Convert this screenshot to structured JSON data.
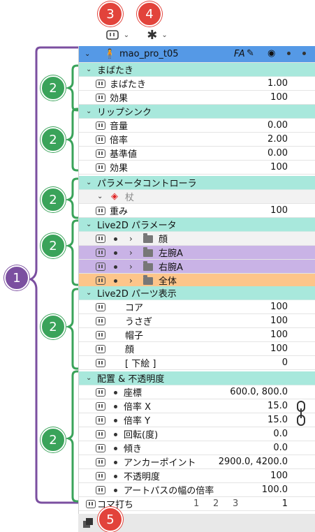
{
  "callouts": [
    "1",
    "2",
    "3",
    "4",
    "5"
  ],
  "model": {
    "name": "mao_pro_t05",
    "fa_label": "FA"
  },
  "groups": [
    {
      "title": "まばたき",
      "rows": [
        {
          "label": "まばたき",
          "value": "1.00"
        },
        {
          "label": "効果",
          "value": "100"
        }
      ]
    },
    {
      "title": "リップシンク",
      "rows": [
        {
          "label": "音量",
          "value": "0.00"
        },
        {
          "label": "倍率",
          "value": "2.00"
        },
        {
          "label": "基準値",
          "value": "0.00"
        },
        {
          "label": "効果",
          "value": "100"
        }
      ]
    },
    {
      "title": "パラメータコントローラ",
      "controller": "杖",
      "rows": [
        {
          "label": "重み",
          "value": "100"
        }
      ]
    },
    {
      "title": "Live2D パラメータ",
      "folders": [
        {
          "label": "顔"
        },
        {
          "label": "左腕A"
        },
        {
          "label": "右腕A"
        },
        {
          "label": "全体"
        }
      ]
    },
    {
      "title": "Live2D パーツ表示",
      "rows": [
        {
          "label": "コア",
          "value": "100"
        },
        {
          "label": "うさぎ",
          "value": "100"
        },
        {
          "label": "帽子",
          "value": "100"
        },
        {
          "label": "顔",
          "value": "100"
        },
        {
          "label": "[ 下絵 ]",
          "value": "0"
        }
      ]
    },
    {
      "title": "配置 & 不透明度",
      "rows": [
        {
          "label": "座標",
          "value": "600.0,  800.0"
        },
        {
          "label": "倍率 X",
          "value": "15.0"
        },
        {
          "label": "倍率 Y",
          "value": "15.0"
        },
        {
          "label": "回転(度)",
          "value": "0.0"
        },
        {
          "label": "傾き",
          "value": "0.0"
        },
        {
          "label": "アンカーポイント",
          "value": "2900.0,  4200.0"
        },
        {
          "label": "不透明度",
          "value": "100"
        },
        {
          "label": "アートパスの幅の倍率",
          "value": "100.0"
        }
      ]
    }
  ],
  "koma": {
    "label": "コマ打ち",
    "marks": [
      "1",
      "2",
      "3"
    ],
    "value": "1"
  },
  "colors": {
    "accent_teal": "#a8e8dc",
    "title_blue": "#5599e6",
    "folder_purple": "#c9b3e6",
    "folder_orange": "#fdc58a",
    "callout_green": "#3aa35a",
    "callout_purple": "#7b4fa0",
    "callout_red": "#e2433b"
  }
}
